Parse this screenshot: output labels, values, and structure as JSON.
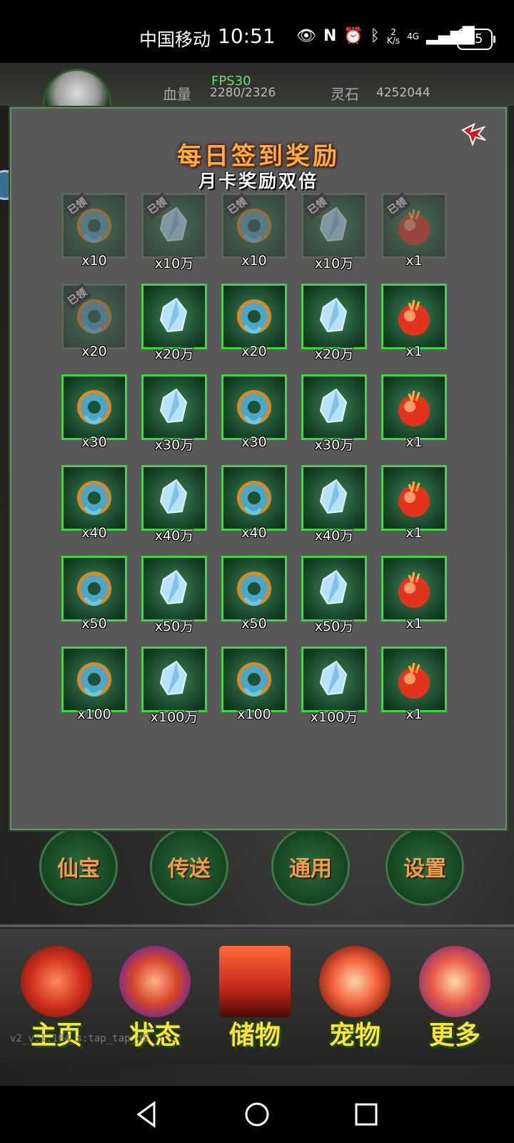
{
  "status_bar": {
    "carrier": "中国移动",
    "time": "10:51",
    "net_speed_top": "2",
    "net_speed_bottom": "K/s",
    "network": "4G",
    "battery": "55"
  },
  "top_bar": {
    "hp_label": "血量",
    "hp_value": "2280/2326",
    "fps": "FPS30",
    "spirit_stone_label": "灵石",
    "spirit_stone_value": "4252044"
  },
  "modal": {
    "title": "每日签到奖励",
    "subtitle": "月卡奖励双倍",
    "claimed_stamp": "已领",
    "rows": [
      [
        {
          "icon": "jade-ring",
          "qty": "x10",
          "claimed": true
        },
        {
          "icon": "crystal",
          "qty": "x10万",
          "claimed": true
        },
        {
          "icon": "jade-ring",
          "qty": "x10",
          "claimed": true
        },
        {
          "icon": "crystal",
          "qty": "x10万",
          "claimed": true
        },
        {
          "icon": "fire-orb",
          "qty": "x1",
          "claimed": true
        }
      ],
      [
        {
          "icon": "jade-ring",
          "qty": "x20",
          "claimed": true
        },
        {
          "icon": "crystal",
          "qty": "x20万",
          "claimed": false
        },
        {
          "icon": "jade-ring",
          "qty": "x20",
          "claimed": false
        },
        {
          "icon": "crystal",
          "qty": "x20万",
          "claimed": false
        },
        {
          "icon": "fire-orb",
          "qty": "x1",
          "claimed": false
        }
      ],
      [
        {
          "icon": "jade-ring",
          "qty": "x30",
          "claimed": false
        },
        {
          "icon": "crystal",
          "qty": "x30万",
          "claimed": false
        },
        {
          "icon": "jade-ring",
          "qty": "x30",
          "claimed": false
        },
        {
          "icon": "crystal",
          "qty": "x30万",
          "claimed": false
        },
        {
          "icon": "fire-orb",
          "qty": "x1",
          "claimed": false
        }
      ],
      [
        {
          "icon": "jade-ring",
          "qty": "x40",
          "claimed": false
        },
        {
          "icon": "crystal",
          "qty": "x40万",
          "claimed": false
        },
        {
          "icon": "jade-ring",
          "qty": "x40",
          "claimed": false
        },
        {
          "icon": "crystal",
          "qty": "x40万",
          "claimed": false
        },
        {
          "icon": "fire-orb",
          "qty": "x1",
          "claimed": false
        }
      ],
      [
        {
          "icon": "jade-ring",
          "qty": "x50",
          "claimed": false
        },
        {
          "icon": "crystal",
          "qty": "x50万",
          "claimed": false
        },
        {
          "icon": "jade-ring",
          "qty": "x50",
          "claimed": false
        },
        {
          "icon": "crystal",
          "qty": "x50万",
          "claimed": false
        },
        {
          "icon": "fire-orb",
          "qty": "x1",
          "claimed": false
        }
      ],
      [
        {
          "icon": "jade-ring",
          "qty": "x100",
          "claimed": false
        },
        {
          "icon": "crystal",
          "qty": "x100万",
          "claimed": false
        },
        {
          "icon": "jade-ring",
          "qty": "x100",
          "claimed": false
        },
        {
          "icon": "crystal",
          "qty": "x100万",
          "claimed": false
        },
        {
          "icon": "fire-orb",
          "qty": "x1",
          "claimed": false
        }
      ]
    ]
  },
  "mid_buttons": [
    "仙宝",
    "传送",
    "通用",
    "设置"
  ],
  "nav": [
    {
      "label": "主页"
    },
    {
      "label": "状态"
    },
    {
      "label": "储物"
    },
    {
      "label": "宠物"
    },
    {
      "label": "更多"
    }
  ],
  "version": "v2_v:1.104_s:tap_tap_d5",
  "colors": {
    "tile_border": "#3fd33f",
    "title": "#f5b03d",
    "nav_label": "#ffe23a"
  }
}
